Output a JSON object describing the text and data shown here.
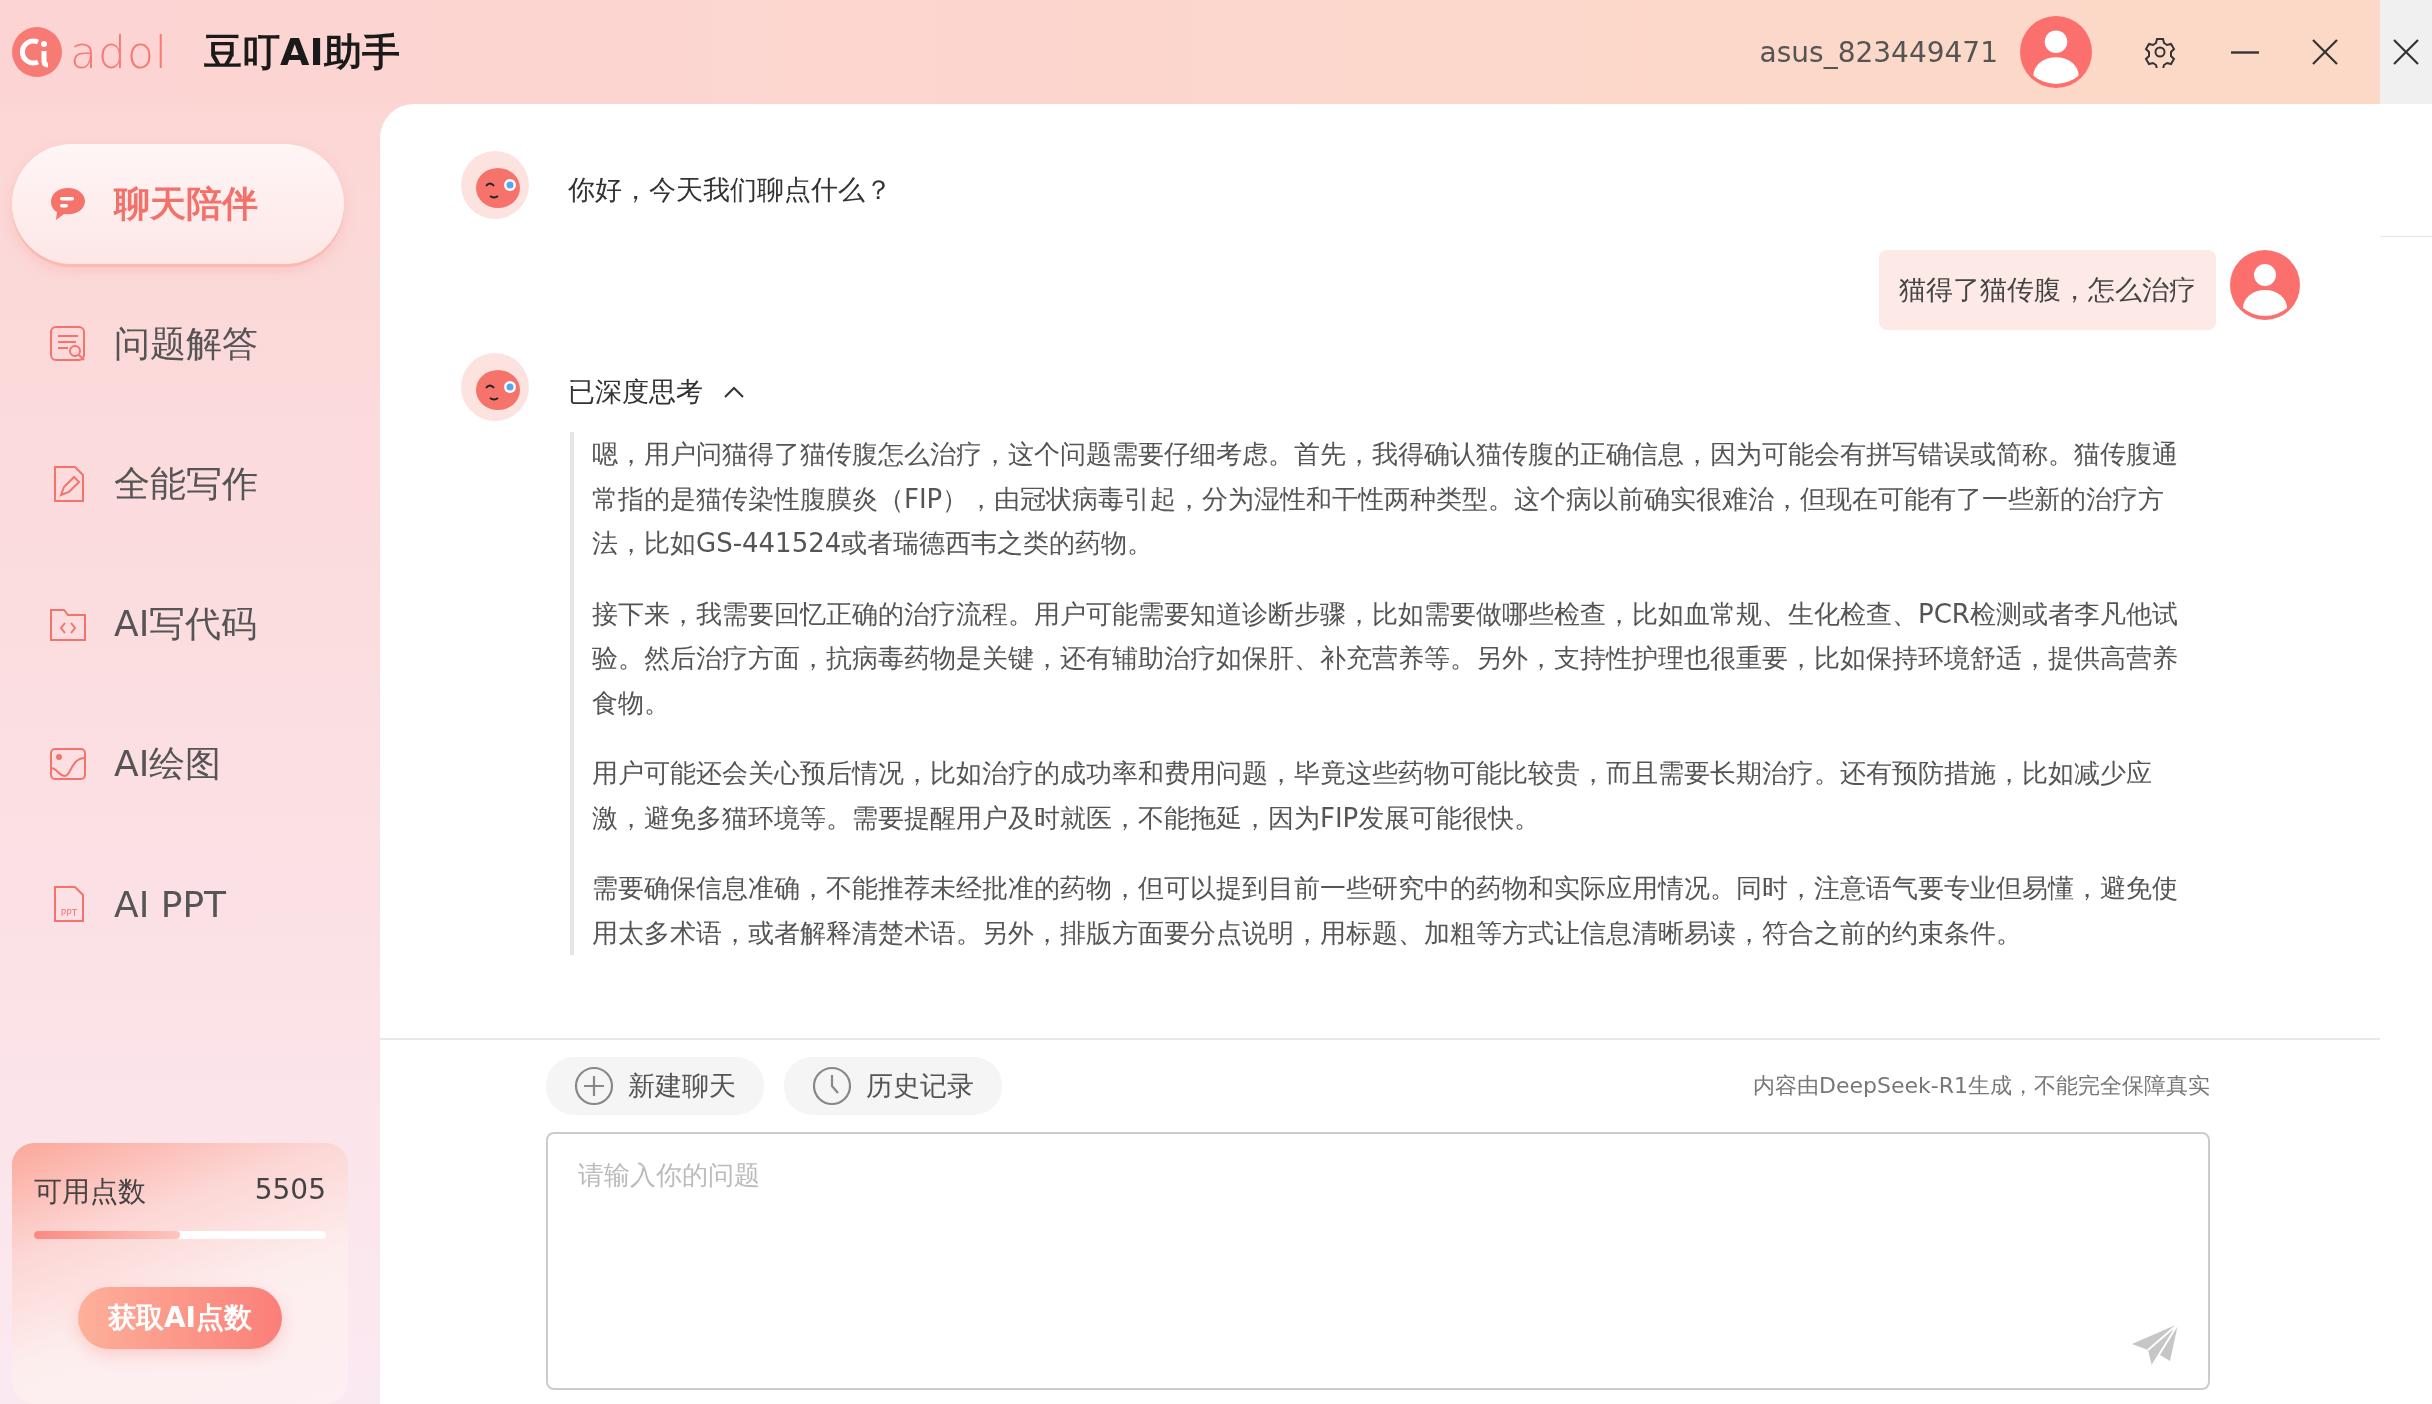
{
  "app": {
    "logo_text": "adol",
    "title": "豆叮AI助手"
  },
  "user": {
    "name": "asus_823449471"
  },
  "sidebar": {
    "items": [
      {
        "kind": "chat",
        "label": "聊天陪伴",
        "selected": true
      },
      {
        "kind": "qa",
        "label": "问题解答",
        "selected": false
      },
      {
        "kind": "write",
        "label": "全能写作",
        "selected": false
      },
      {
        "kind": "code",
        "label": "AI写代码",
        "selected": false
      },
      {
        "kind": "draw",
        "label": "AI绘图",
        "selected": false
      },
      {
        "kind": "ppt",
        "label": "AI PPT",
        "icon_label": "PPT",
        "selected": false
      }
    ]
  },
  "points": {
    "label": "可用点数",
    "value": "5505",
    "level": 0.5,
    "button": "获取AI点数"
  },
  "chat": {
    "greeting": "你好，今天我们聊点什么？",
    "user_message": "猫得了猫传腹，怎么治疗",
    "thinking": {
      "label": "已深度思考",
      "expanded": true,
      "paragraphs": [
        "嗯，用户问猫得了猫传腹怎么治疗，这个问题需要仔细考虑。首先，我得确认猫传腹的正确信息，因为可能会有拼写错误或简称。猫传腹通常指的是猫传染性腹膜炎（FIP），由冠状病毒引起，分为湿性和干性两种类型。这个病以前确实很难治，但现在可能有了一些新的治疗方法，比如GS-441524或者瑞德西韦之类的药物。",
        "接下来，我需要回忆正确的治疗流程。用户可能需要知道诊断步骤，比如需要做哪些检查，比如血常规、生化检查、PCR检测或者李凡他试验。然后治疗方面，抗病毒药物是关键，还有辅助治疗如保肝、补充营养等。另外，支持性护理也很重要，比如保持环境舒适，提供高营养食物。",
        "用户可能还会关心预后情况，比如治疗的成功率和费用问题，毕竟这些药物可能比较贵，而且需要长期治疗。还有预防措施，比如减少应激，避免多猫环境等。需要提醒用户及时就医，不能拖延，因为FIP发展可能很快。",
        "需要确保信息准确，不能推荐未经批准的药物，但可以提到目前一些研究中的药物和实际应用情况。同时，注意语气要专业但易懂，避免使用太多术语，或者解释清楚术语。另外，排版方面要分点说明，用标题、加粗等方式让信息清晰易读，符合之前的约束条件。"
      ]
    }
  },
  "actions": [
    {
      "kind": "new",
      "label": "新建聊天"
    },
    {
      "kind": "history",
      "label": "历史记录"
    }
  ],
  "disclaimer": "内容由DeepSeek-R1生成，不能完全保障真实",
  "input": {
    "placeholder": "请输入你的问题"
  }
}
